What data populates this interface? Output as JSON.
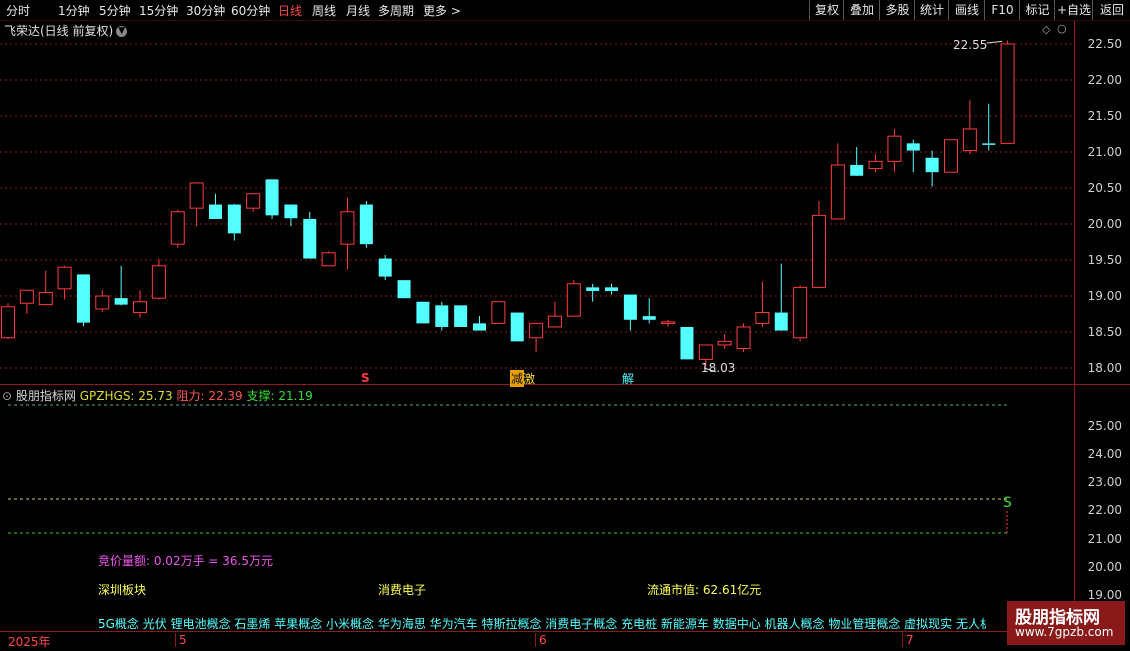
{
  "toolbar": {
    "timeframes": [
      "分时",
      "1分钟",
      "5分钟",
      "15分钟",
      "30分钟",
      "60分钟",
      "日线",
      "周线",
      "月线",
      "多周期",
      "更多"
    ],
    "more_arrow": ">",
    "active": "日线",
    "right_buttons": [
      "复权",
      "叠加",
      "多股",
      "统计",
      "画线",
      "F10",
      "标记",
      "+自选",
      "返回"
    ]
  },
  "chart_title": "飞荣达(日线 前复权)",
  "price_axis": [
    "22.50",
    "22.00",
    "21.50",
    "21.00",
    "20.50",
    "20.00",
    "19.50",
    "19.00",
    "18.50",
    "18.00"
  ],
  "annotations": {
    "high": "22.55",
    "low": "18.03",
    "signal_s": "S",
    "signal_jian": "减",
    "signal_ji": "激",
    "signal_jie": "解"
  },
  "indicator": {
    "name": "股朋指标网",
    "code_label": "GPZHGS: 25.73",
    "resistance": "阻力: 22.39",
    "support": "支撑: 21.19",
    "axis": [
      "25.00",
      "24.00",
      "23.00",
      "22.00",
      "21.00",
      "20.00",
      "19.00"
    ],
    "s_marker": "S",
    "auction": "竞价量额: 0.02万手 = 36.5万元",
    "board": "深圳板块",
    "industry": "消费电子",
    "market_cap": "流通市值: 62.61亿元",
    "concepts": "5G概念 光伏 锂电池概念 石墨烯 苹果概念 小米概念 华为海思 华为汽车 特斯拉概念 消费电子概念 充电桩 新能源车 数据中心 机器人概念 物业管理概念 虚拟现实 无人机 元"
  },
  "date_axis": [
    "2025年",
    "5",
    "6",
    "7"
  ],
  "watermark": {
    "line1": "股朋指标网",
    "line2": "www.7gpzb.com"
  },
  "colors": {
    "up": "#ff3c3c",
    "down": "#54ffff",
    "grid": "#8b1a1a",
    "active_tab": "#ff4a4a"
  },
  "chart_data": {
    "type": "candlestick",
    "y_range": [
      17.9,
      22.6
    ],
    "candles": [
      {
        "o": 18.42,
        "h": 18.9,
        "l": 18.4,
        "c": 18.85
      },
      {
        "o": 18.9,
        "h": 19.05,
        "l": 18.75,
        "c": 19.08
      },
      {
        "o": 18.88,
        "h": 19.35,
        "l": 18.9,
        "c": 19.05
      },
      {
        "o": 19.1,
        "h": 19.42,
        "l": 18.95,
        "c": 19.4
      },
      {
        "o": 19.3,
        "h": 19.3,
        "l": 18.58,
        "c": 18.63
      },
      {
        "o": 18.82,
        "h": 19.08,
        "l": 18.78,
        "c": 19.0
      },
      {
        "o": 18.97,
        "h": 19.42,
        "l": 18.87,
        "c": 18.88
      },
      {
        "o": 18.77,
        "h": 19.08,
        "l": 18.7,
        "c": 18.92
      },
      {
        "o": 18.97,
        "h": 19.52,
        "l": 18.95,
        "c": 19.42
      },
      {
        "o": 19.72,
        "h": 20.2,
        "l": 19.67,
        "c": 20.17
      },
      {
        "o": 20.22,
        "h": 20.55,
        "l": 19.97,
        "c": 20.57
      },
      {
        "o": 20.27,
        "h": 20.42,
        "l": 20.07,
        "c": 20.07
      },
      {
        "o": 20.27,
        "h": 20.28,
        "l": 19.77,
        "c": 19.87
      },
      {
        "o": 20.22,
        "h": 20.42,
        "l": 20.17,
        "c": 20.42
      },
      {
        "o": 20.62,
        "h": 20.62,
        "l": 20.07,
        "c": 20.12
      },
      {
        "o": 20.27,
        "h": 20.22,
        "l": 19.97,
        "c": 20.08
      },
      {
        "o": 20.07,
        "h": 20.17,
        "l": 19.52,
        "c": 19.52
      },
      {
        "o": 19.42,
        "h": 19.62,
        "l": 19.42,
        "c": 19.6
      },
      {
        "o": 19.72,
        "h": 20.37,
        "l": 19.37,
        "c": 20.17
      },
      {
        "o": 20.27,
        "h": 20.32,
        "l": 19.67,
        "c": 19.72
      },
      {
        "o": 19.52,
        "h": 19.57,
        "l": 19.22,
        "c": 19.27
      },
      {
        "o": 19.22,
        "h": 19.22,
        "l": 18.97,
        "c": 18.97
      },
      {
        "o": 18.92,
        "h": 18.92,
        "l": 18.62,
        "c": 18.62
      },
      {
        "o": 18.87,
        "h": 18.92,
        "l": 18.52,
        "c": 18.57
      },
      {
        "o": 18.87,
        "h": 18.87,
        "l": 18.57,
        "c": 18.57
      },
      {
        "o": 18.62,
        "h": 18.72,
        "l": 18.52,
        "c": 18.52
      },
      {
        "o": 18.62,
        "h": 18.92,
        "l": 18.67,
        "c": 18.92
      },
      {
        "o": 18.77,
        "h": 18.77,
        "l": 18.37,
        "c": 18.37
      },
      {
        "o": 18.42,
        "h": 18.62,
        "l": 18.22,
        "c": 18.62
      },
      {
        "o": 18.57,
        "h": 18.92,
        "l": 18.57,
        "c": 18.72
      },
      {
        "o": 18.72,
        "h": 19.22,
        "l": 18.77,
        "c": 19.17
      },
      {
        "o": 19.12,
        "h": 19.17,
        "l": 18.92,
        "c": 19.07
      },
      {
        "o": 19.12,
        "h": 19.17,
        "l": 19.02,
        "c": 19.07
      },
      {
        "o": 19.02,
        "h": 19.02,
        "l": 18.52,
        "c": 18.67
      },
      {
        "o": 18.72,
        "h": 18.97,
        "l": 18.62,
        "c": 18.67
      },
      {
        "o": 18.62,
        "h": 18.67,
        "l": 18.57,
        "c": 18.64
      },
      {
        "o": 18.57,
        "h": 18.57,
        "l": 18.12,
        "c": 18.12
      },
      {
        "o": 18.12,
        "h": 18.32,
        "l": 18.03,
        "c": 18.32
      },
      {
        "o": 18.32,
        "h": 18.47,
        "l": 18.27,
        "c": 18.37
      },
      {
        "o": 18.27,
        "h": 18.62,
        "l": 18.22,
        "c": 18.57
      },
      {
        "o": 18.62,
        "h": 19.2,
        "l": 18.57,
        "c": 18.77
      },
      {
        "o": 18.77,
        "h": 19.45,
        "l": 18.57,
        "c": 18.52
      },
      {
        "o": 18.42,
        "h": 19.15,
        "l": 18.37,
        "c": 19.12
      },
      {
        "o": 19.12,
        "h": 20.32,
        "l": 19.12,
        "c": 20.12
      },
      {
        "o": 20.07,
        "h": 21.12,
        "l": 20.07,
        "c": 20.82
      },
      {
        "o": 20.82,
        "h": 21.07,
        "l": 20.67,
        "c": 20.67
      },
      {
        "o": 20.77,
        "h": 20.97,
        "l": 20.72,
        "c": 20.87
      },
      {
        "o": 20.87,
        "h": 21.32,
        "l": 20.72,
        "c": 21.22
      },
      {
        "o": 21.12,
        "h": 21.17,
        "l": 20.72,
        "c": 21.02
      },
      {
        "o": 20.92,
        "h": 21.02,
        "l": 20.52,
        "c": 20.72
      },
      {
        "o": 20.72,
        "h": 21.12,
        "l": 20.72,
        "c": 21.17
      },
      {
        "o": 21.02,
        "h": 21.72,
        "l": 20.97,
        "c": 21.32
      },
      {
        "o": 21.12,
        "h": 21.67,
        "l": 21.02,
        "c": 21.1
      },
      {
        "o": 21.12,
        "h": 22.55,
        "l": 21.12,
        "c": 22.5
      }
    ]
  }
}
